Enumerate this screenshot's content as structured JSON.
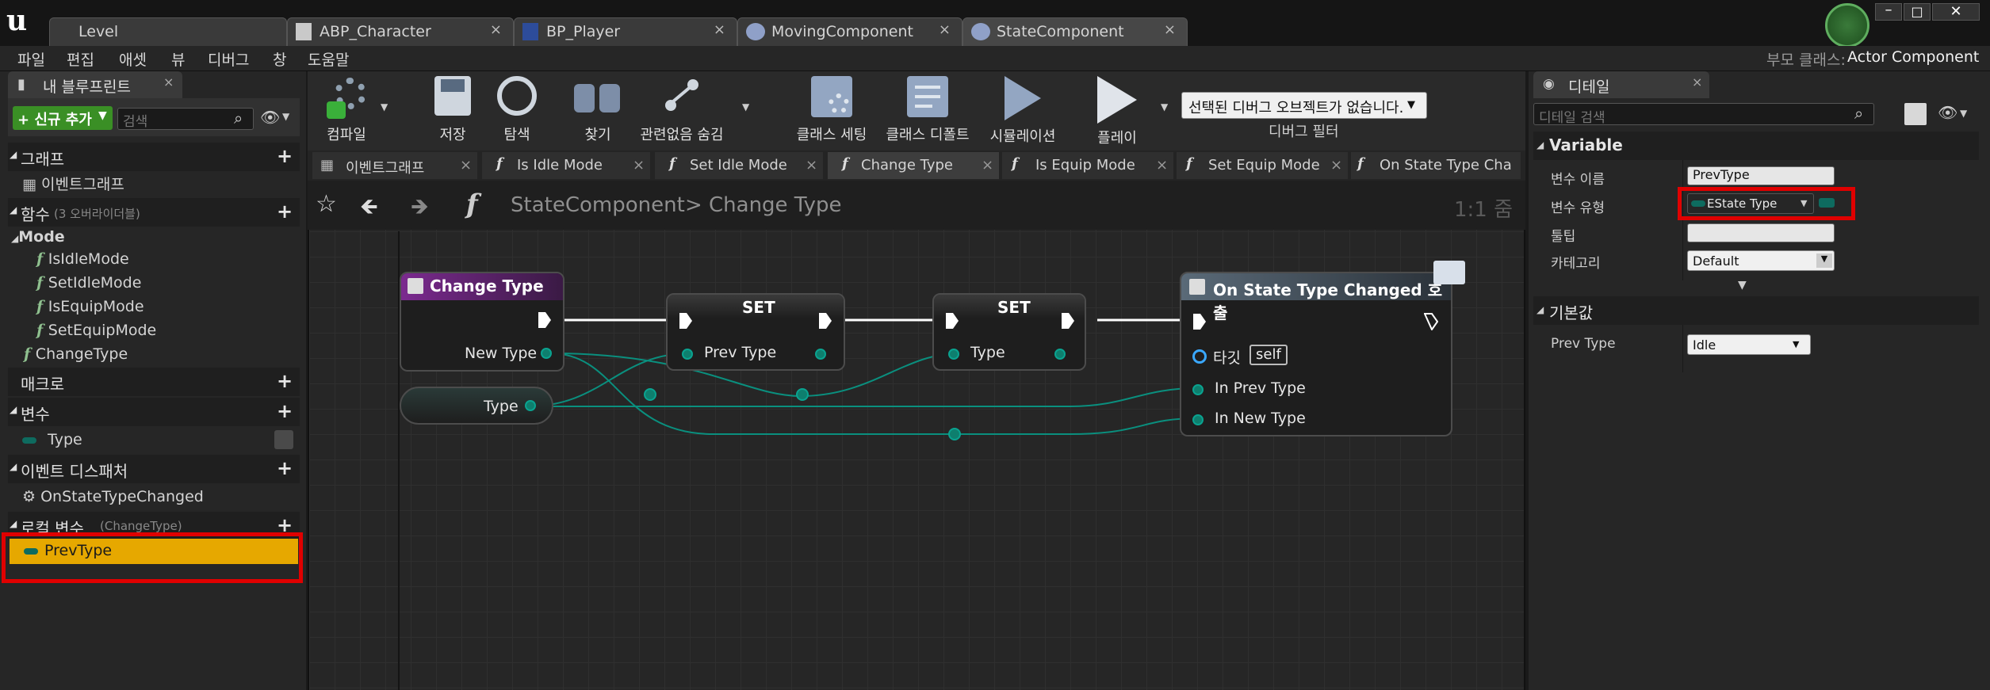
{
  "tabs": [
    {
      "label": "Level",
      "active": false
    },
    {
      "label": "ABP_Character",
      "active": false
    },
    {
      "label": "BP_Player",
      "active": false
    },
    {
      "label": "MovingComponent",
      "active": false
    },
    {
      "label": "StateComponent",
      "active": true
    }
  ],
  "menu": [
    "파일",
    "편집",
    "애셋",
    "뷰",
    "디버그",
    "창",
    "도움말"
  ],
  "parent_class": {
    "label": "부모 클래스:",
    "value": "Actor Component"
  },
  "my_blueprint": {
    "tab_label": "내 블루프린트",
    "add_new": "+ 신규 추가",
    "search_placeholder": "검색",
    "graphs": {
      "title": "그래프",
      "items": [
        "이벤트그래프"
      ]
    },
    "functions": {
      "title": "함수",
      "count": "(3 오버라이더블)"
    },
    "mode": {
      "title": "Mode",
      "items": [
        "IsIdleMode",
        "SetIdleMode",
        "IsEquipMode",
        "SetEquipMode"
      ]
    },
    "change_type": "ChangeType",
    "macros": {
      "title": "매크로"
    },
    "variables": {
      "title": "변수",
      "items": [
        "Type"
      ]
    },
    "dispatchers": {
      "title": "이벤트 디스패처",
      "items": [
        "OnStateTypeChanged"
      ]
    },
    "local_vars": {
      "title": "로컬 변수",
      "context": "(ChangeType)",
      "items": [
        "PrevType"
      ]
    }
  },
  "toolbar": {
    "buttons": [
      "컴파일",
      "저장",
      "탐색",
      "찾기",
      "관련없음 숨김",
      "클래스 세팅",
      "클래스 디폴트",
      "시뮬레이션",
      "플레이"
    ],
    "debug_select": "선택된 디버그 오브젝트가 없습니다.",
    "debug_filter": "디버그 필터"
  },
  "graph_tabs": [
    "이벤트그래프",
    "Is Idle Mode",
    "Set Idle Mode",
    "Change Type",
    "Is Equip Mode",
    "Set Equip Mode",
    "On State Type Cha"
  ],
  "graph": {
    "breadcrumb_root": "StateComponent",
    "breadcrumb_sep": ">",
    "breadcrumb_current": "Change Type",
    "zoom": "1:1 줌",
    "nodes": {
      "entry": {
        "title": "Change Type",
        "pin": "New Type"
      },
      "type_getter": {
        "label": "Type"
      },
      "set1": {
        "title": "SET",
        "pin": "Prev Type"
      },
      "set2": {
        "title": "SET",
        "pin": "Type"
      },
      "call": {
        "title": "On State Type Changed 호출",
        "target_label": "타깃",
        "target_value": "self",
        "pins": [
          "In Prev Type",
          "In New Type"
        ]
      }
    }
  },
  "details": {
    "tab_label": "디테일",
    "search_placeholder": "디테일 검색",
    "variable_section": "Variable",
    "rows": [
      {
        "label": "변수 이름",
        "value": "PrevType"
      },
      {
        "label": "변수 유형",
        "value": "EState Type"
      },
      {
        "label": "툴팁",
        "value": ""
      },
      {
        "label": "카테고리",
        "value": "Default"
      }
    ],
    "default_section": "기본값",
    "default_row": {
      "label": "Prev Type",
      "value": "Idle"
    }
  },
  "colors": {
    "highlight": "#e6a800",
    "red_box": "#e00000",
    "enum_pin": "#0aa390"
  }
}
